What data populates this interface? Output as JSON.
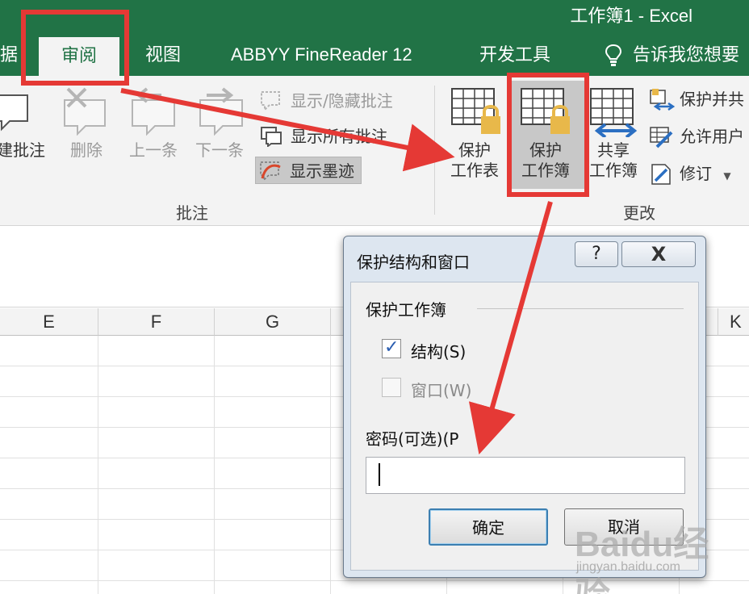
{
  "window": {
    "title": "工作簿1 - Excel"
  },
  "tabs": [
    {
      "label": "据",
      "active": false
    },
    {
      "label": "审阅",
      "active": true
    },
    {
      "label": "视图",
      "active": false
    },
    {
      "label": "ABBYY FineReader 12",
      "active": false
    },
    {
      "label": "开发工具",
      "active": false
    },
    {
      "label": "告诉我您想要",
      "active": false
    }
  ],
  "tellme_icon": "lightbulb-icon",
  "ribbon": {
    "comments_group": {
      "label": "批注",
      "new_comment": "建批注",
      "delete": "删除",
      "previous": "上一条",
      "next": "下一条",
      "show_hide_comment": "显示/隐藏批注",
      "show_all_comments": "显示所有批注",
      "show_ink": "显示墨迹"
    },
    "changes_group": {
      "label": "更改",
      "protect_sheet": [
        "保护",
        "工作表"
      ],
      "protect_workbook": [
        "保护",
        "工作簿"
      ],
      "share_workbook": [
        "共享",
        "工作簿"
      ],
      "protect_and_share": "保护并共",
      "allow_users": "允许用户",
      "track_changes": "修订"
    }
  },
  "sheet": {
    "columns": [
      "E",
      "F",
      "G",
      "K"
    ]
  },
  "dialog": {
    "title": "保护结构和窗口",
    "help_label": "?",
    "close_label": "X",
    "section_label": "保护工作簿",
    "structure_label": "结构(S)",
    "structure_checked": true,
    "window_label": "窗口(W)",
    "window_checked": false,
    "password_label": "密码(可选)(P",
    "password_value": "",
    "ok_label": "确定",
    "cancel_label": "取消"
  },
  "watermark": {
    "logo": "Baidu经验",
    "url": "jingyan.baidu.com"
  },
  "colors": {
    "excel_green": "#217346",
    "annotation_red": "#e53935"
  }
}
